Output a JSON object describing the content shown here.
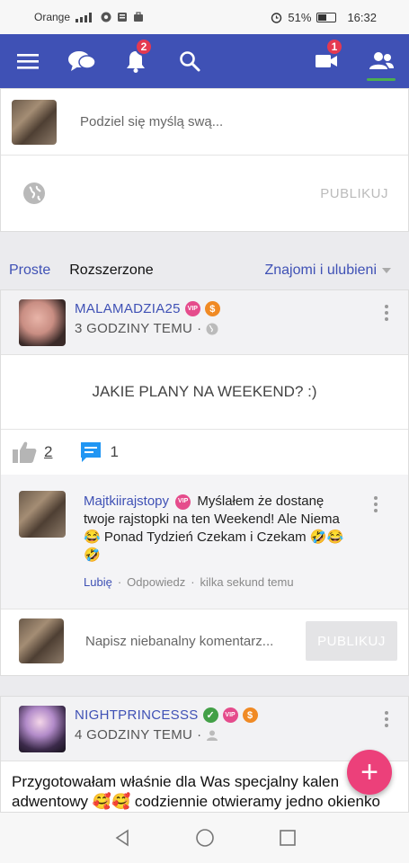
{
  "status_bar": {
    "carrier": "Orange",
    "battery": "51%",
    "battery_level": 0.51,
    "time": "16:32"
  },
  "nav": {
    "notifications_badge": "2",
    "video_badge": "1"
  },
  "composer": {
    "placeholder": "Podziel się myślą swą...",
    "publish_label": "PUBLIKUJ"
  },
  "filters": {
    "tab_simple": "Proste",
    "tab_extended": "Rozszerzone",
    "dropdown": "Znajomi i ulubieni"
  },
  "post1": {
    "username": "MALAMADZIA25",
    "vip": "VIP",
    "dollar": "$",
    "time": "3 GODZINY TEMU",
    "body": "JAKIE PLANY NA WEEKEND? :)",
    "likes": "2",
    "comments": "1",
    "comment": {
      "author": "Majtkiirajstopy",
      "text": "Myślałem że dostanę twoje rajstopki na ten Weekend! Ale Niema 😂 Ponad Tydzień Czekam i Czekam 🤣😂🤣",
      "like_label": "Lubię",
      "reply_label": "Odpowiedz",
      "time": "kilka sekund temu"
    },
    "reply_placeholder": "Napisz niebanalny komentarz...",
    "reply_publish": "PUBLIKUJ"
  },
  "post2": {
    "username": "NIGHTPRINCESSS",
    "vip": "VIP",
    "dollar": "$",
    "check": "✓",
    "time": "4 GODZINY TEMU",
    "body_line1": "Przygotowałam właśnie dla Was specjalny kalen",
    "body_line2": "adwentowy 🥰🥰 codziennie otwieramy jedno okienko"
  },
  "fab": {
    "label": "+"
  }
}
